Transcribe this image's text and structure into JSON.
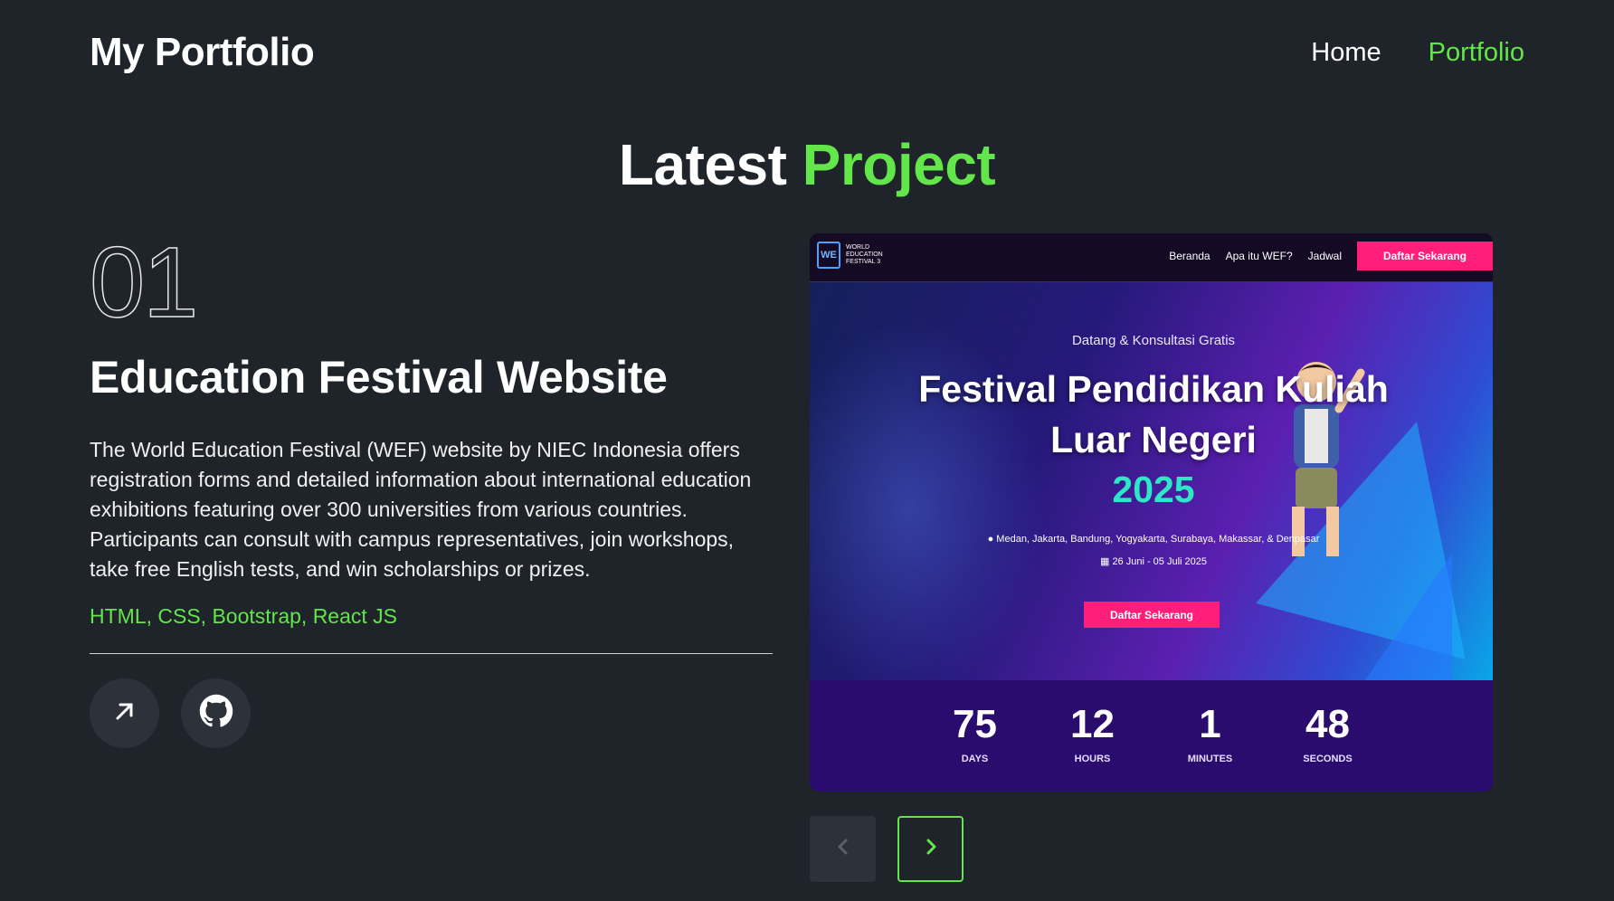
{
  "header": {
    "logo": "My Portfolio",
    "nav": [
      {
        "label": "Home",
        "active": false
      },
      {
        "label": "Portfolio",
        "active": true
      }
    ]
  },
  "section": {
    "title_main": "Latest",
    "title_accent": "Project"
  },
  "project": {
    "number": "01",
    "title": "Education Festival Website",
    "description": "The World Education Festival (WEF) website by NIEC Indonesia offers registration forms and detailed information about international education exhibitions featuring over 300 universities from various countries. Participants can consult with campus representatives, join workshops, take free English tests, and win scholarships or prizes.",
    "stack": "HTML, CSS, Bootstrap, React JS",
    "buttons": [
      {
        "icon": "arrow-up-right-icon"
      },
      {
        "icon": "github-icon"
      }
    ]
  },
  "screenshot": {
    "logo_mark": "WE",
    "logo_text": "WORLD EDUCATION FESTIVAL 3",
    "nav": [
      "Beranda",
      "Apa itu WEF?",
      "Jadwal"
    ],
    "cta": "Daftar Sekarang",
    "hero": {
      "subtitle": "Datang & Konsultasi Gratis",
      "title_line1": "Festival Pendidikan Kuliah",
      "title_line2": "Luar Negeri",
      "year": "2025",
      "locations": "Medan, Jakarta, Bandung, Yogyakarta, Surabaya, Makassar, & Denpasar",
      "dates": "26 Juni - 05 Juli 2025",
      "cta": "Daftar Sekarang"
    },
    "countdown": [
      {
        "value": "75",
        "label": "DAYS"
      },
      {
        "value": "12",
        "label": "HOURS"
      },
      {
        "value": "1",
        "label": "MINUTES"
      },
      {
        "value": "48",
        "label": "SECONDS"
      }
    ]
  },
  "colors": {
    "background": "#1f232a",
    "accent": "#62e64a",
    "pink": "#ff1f7a",
    "teal": "#2ee6c8"
  }
}
